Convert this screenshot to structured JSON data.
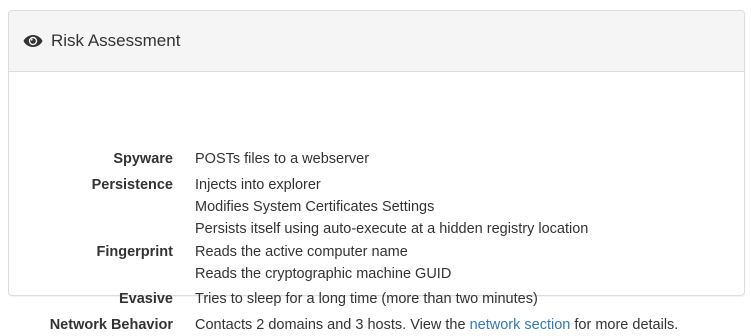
{
  "panel": {
    "title": "Risk Assessment",
    "icon": "eye-icon"
  },
  "items": [
    {
      "term": "Spyware",
      "lines": [
        "POSTs files to a webserver"
      ]
    },
    {
      "term": "Persistence",
      "lines": [
        "Injects into explorer",
        "Modifies System Certificates Settings",
        "Persists itself using auto-execute at a hidden registry location"
      ]
    },
    {
      "term": "Fingerprint",
      "lines": [
        "Reads the active computer name",
        "Reads the cryptographic machine GUID"
      ]
    },
    {
      "term": "Evasive",
      "lines": [
        "Tries to sleep for a long time (more than two minutes)"
      ]
    },
    {
      "term": "Network Behavior",
      "network": {
        "before": "Contacts 2 domains and 3 hosts. View the ",
        "link": "network section",
        "after": " for more details."
      }
    }
  ],
  "colors": {
    "link": "#337ab7",
    "heading_bg": "#f5f5f5",
    "border": "#dddddd"
  }
}
